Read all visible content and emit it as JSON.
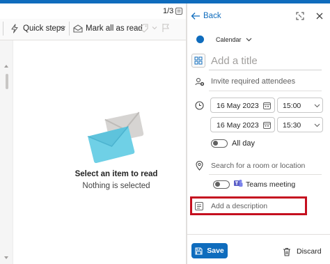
{
  "colors": {
    "accent": "#0f6cbd",
    "highlight_box": "#c50f1f",
    "calendar_dot": "#0f6cbd",
    "teams": "#5b5fc7"
  },
  "message_list": {
    "page_indicator": "1/3",
    "toolbar": {
      "quick_steps_label": "Quick steps",
      "mark_all_read_label": "Mark all as read"
    },
    "empty_state": {
      "title": "Select an item to read",
      "subtitle": "Nothing is selected"
    }
  },
  "event_pane": {
    "back_label": "Back",
    "calendar_name": "Calendar",
    "title_placeholder": "Add a title",
    "attendees_placeholder": "Invite required attendees",
    "start_date": "16 May 2023",
    "start_time": "15:00",
    "end_date": "16 May 2023",
    "end_time": "15:30",
    "all_day_label": "All day",
    "location_placeholder": "Search for a room or location",
    "teams_label": "Teams meeting",
    "description_placeholder": "Add a description",
    "save_label": "Save",
    "discard_label": "Discard"
  },
  "icons": [
    "envelope-icon",
    "lightning-icon",
    "chevron-down-icon",
    "tag-icon",
    "flag-icon",
    "back-arrow-icon",
    "expand-icon",
    "close-icon",
    "apps-icon",
    "attendees-icon",
    "clock-icon",
    "calendar-icon",
    "location-icon",
    "teams-icon",
    "description-icon",
    "save-icon",
    "trash-icon"
  ]
}
